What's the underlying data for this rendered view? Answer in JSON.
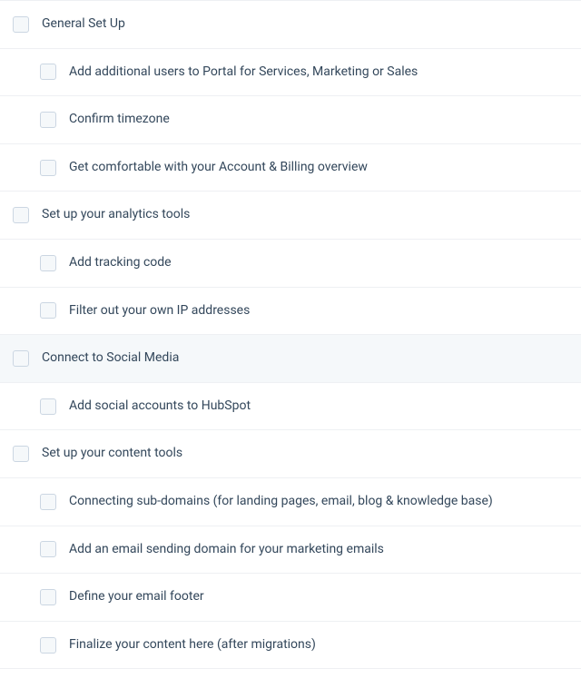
{
  "sections": [
    {
      "id": "general",
      "label": "General Set Up",
      "highlighted": false,
      "items": [
        {
          "id": "add-users",
          "label": "Add additional users to Portal for Services, Marketing or Sales"
        },
        {
          "id": "confirm-timezone",
          "label": "Confirm timezone"
        },
        {
          "id": "account-billing",
          "label": "Get comfortable with your Account & Billing overview"
        }
      ]
    },
    {
      "id": "analytics",
      "label": "Set up your analytics tools",
      "highlighted": false,
      "items": [
        {
          "id": "tracking-code",
          "label": "Add tracking code"
        },
        {
          "id": "filter-ip",
          "label": "Filter out your own IP addresses"
        }
      ]
    },
    {
      "id": "social",
      "label": "Connect to Social Media",
      "highlighted": true,
      "items": [
        {
          "id": "add-social",
          "label": "Add social accounts to HubSpot"
        }
      ]
    },
    {
      "id": "content",
      "label": "Set up your content tools",
      "highlighted": false,
      "items": [
        {
          "id": "subdomains",
          "label": "Connecting sub-domains (for landing pages, email, blog & knowledge base)"
        },
        {
          "id": "email-domain",
          "label": "Add an email sending domain for your marketing emails"
        },
        {
          "id": "email-footer",
          "label": "Define your email footer"
        },
        {
          "id": "finalize-content",
          "label": "Finalize your content here (after migrations)"
        }
      ]
    }
  ]
}
